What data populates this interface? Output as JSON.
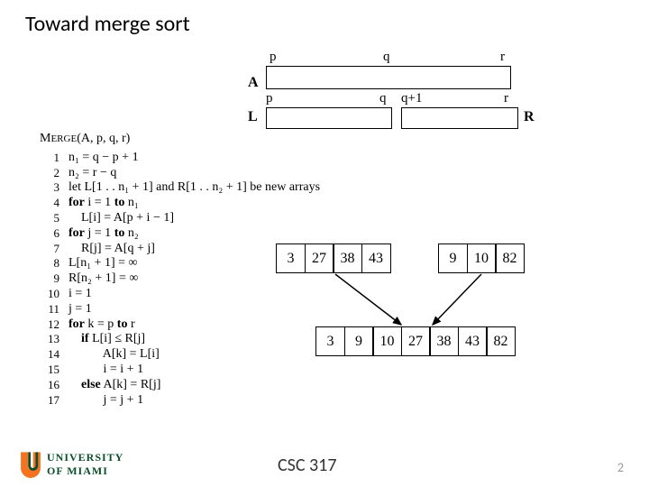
{
  "title": "Toward merge sort",
  "arrays": {
    "A_label": "A",
    "L_label": "L",
    "R_label": "R",
    "p": "p",
    "q": "q",
    "r": "r",
    "qp1": "q+1"
  },
  "pseudocode": {
    "header_small": "MERGE",
    "header_args": "(A, p, q, r)",
    "lines": {
      "l1": "n₁ = q − p + 1",
      "l2": "n₂ = r − q",
      "l3": "let L[1 . . n₁ + 1] and R[1 . . n₂ + 1] be new arrays",
      "l4a": "for",
      "l4b": " i = 1 ",
      "l4c": "to",
      "l4d": " n₁",
      "l5": "    L[i] = A[p + i − 1]",
      "l6a": "for",
      "l6b": " j = 1 ",
      "l6c": "to",
      "l6d": " n₂",
      "l7": "    R[j] = A[q + j]",
      "l8": "L[n₁ + 1] = ∞",
      "l9": "R[n₂ + 1] = ∞",
      "l10": "i = 1",
      "l11": "j = 1",
      "l12a": "for",
      "l12b": " k = p ",
      "l12c": "to",
      "l12d": " r",
      "l13a": "    ",
      "l13b": "if",
      "l13c": " L[i] ≤ R[j]",
      "l14": "           A[k] = L[i]",
      "l15": "           i = i + 1",
      "l16a": "    ",
      "l16b": "else",
      "l16c": " A[k] = R[j]",
      "l17": "           j = j + 1"
    }
  },
  "merge": {
    "left": [
      "3",
      "27",
      "38",
      "43"
    ],
    "right": [
      "9",
      "10",
      "82"
    ],
    "result": [
      "3",
      "9",
      "10",
      "27",
      "38",
      "43",
      "82"
    ]
  },
  "footer": {
    "course": "CSC 317",
    "page": "2",
    "uni1": "UNIVERSITY",
    "uni2": "OF MIAMI"
  }
}
